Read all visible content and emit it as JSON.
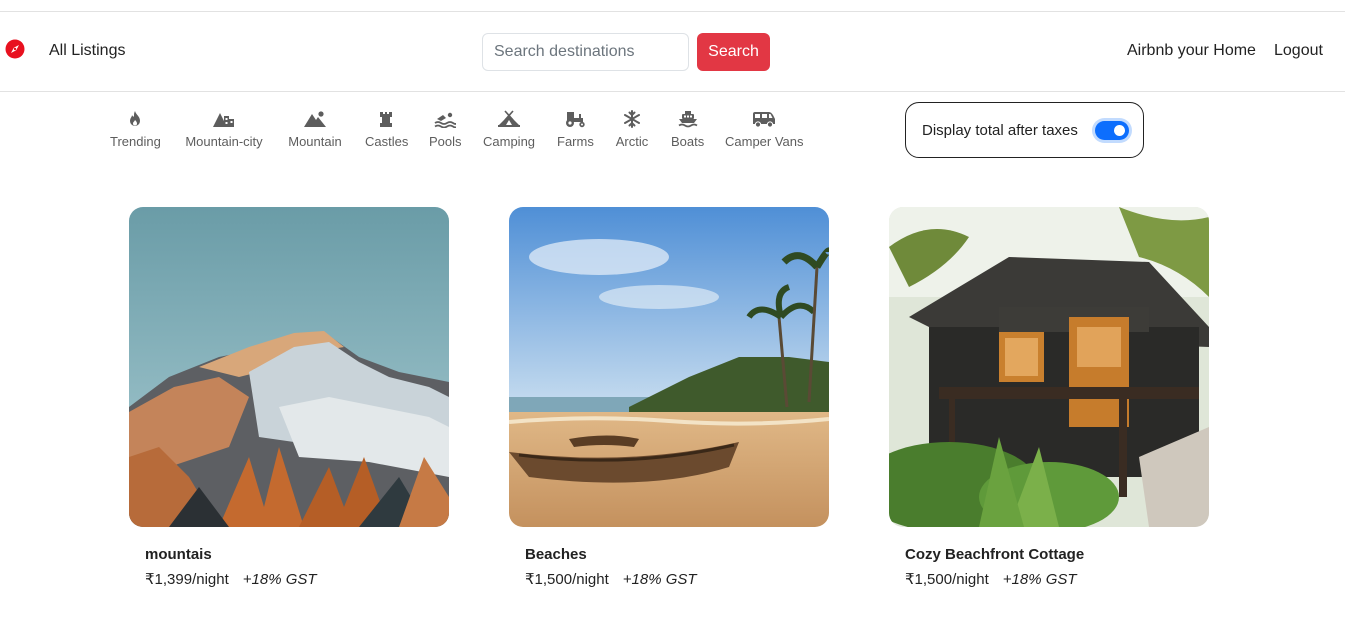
{
  "navbar": {
    "all_listings": "All Listings",
    "search_placeholder": "Search destinations",
    "search_button": "Search",
    "host_link": "Airbnb your Home",
    "logout_link": "Logout"
  },
  "filters": [
    {
      "label": "Trending",
      "icon": "fire-icon"
    },
    {
      "label": "Mountain-city",
      "icon": "mountain-city-icon"
    },
    {
      "label": "Mountain",
      "icon": "mountain-sun-icon"
    },
    {
      "label": "Castles",
      "icon": "chess-rook-icon"
    },
    {
      "label": "Pools",
      "icon": "person-swimming-icon"
    },
    {
      "label": "Camping",
      "icon": "campground-icon"
    },
    {
      "label": "Farms",
      "icon": "tractor-icon"
    },
    {
      "label": "Arctic",
      "icon": "snowflake-icon"
    },
    {
      "label": "Boats",
      "icon": "ferry-icon"
    },
    {
      "label": "Camper Vans",
      "icon": "van-shuttle-icon"
    }
  ],
  "tax_toggle": {
    "label": "Display total after taxes",
    "checked": true
  },
  "listings": [
    {
      "title": "mountais",
      "price": "₹1,399/night",
      "gst": "+18% GST",
      "image": "snowy-mountain-image"
    },
    {
      "title": "Beaches",
      "price": "₹1,500/night",
      "gst": "+18% GST",
      "image": "beach-boat-image"
    },
    {
      "title": "Cozy Beachfront Cottage",
      "price": "₹1,500/night",
      "gst": "+18% GST",
      "image": "wooden-cottage-image"
    }
  ],
  "colors": {
    "brand": "#e23744",
    "toggle": "#0d6efd"
  }
}
